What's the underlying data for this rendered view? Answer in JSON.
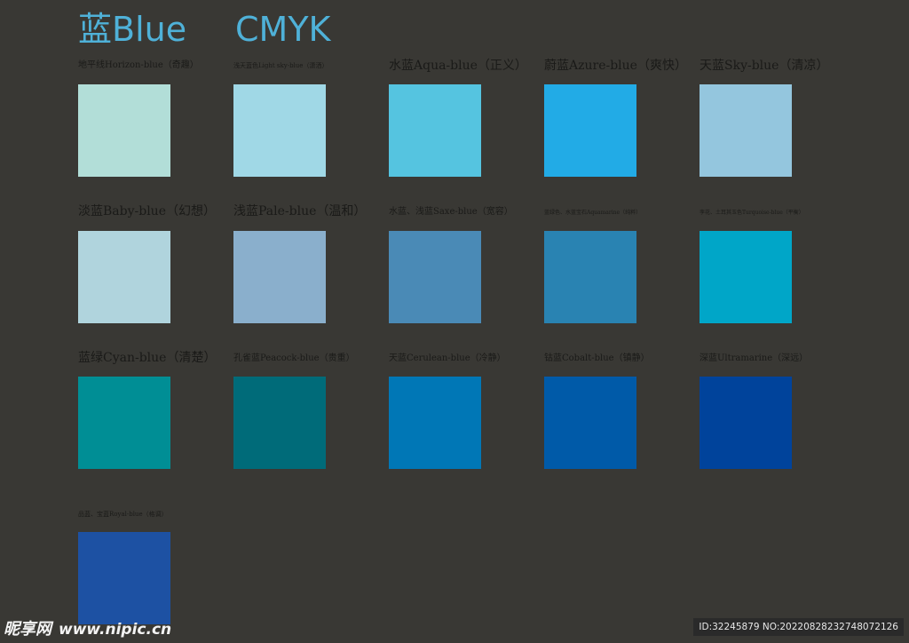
{
  "header": {
    "title_main": "蓝Blue",
    "title_mode": "CMYK"
  },
  "swatches": [
    {
      "label": "地平线Horizon-blue（奇趣）",
      "color": "#b2ded8"
    },
    {
      "label": "浅天蓝色Light sky-blue（潇洒）",
      "color": "#a0d8e6"
    },
    {
      "label": "水蓝Aqua-blue（正义）",
      "color": "#55c4e0"
    },
    {
      "label": "蔚蓝Azure-blue（爽快）",
      "color": "#22abe6"
    },
    {
      "label": "天蓝Sky-blue（清凉）",
      "color": "#94c6de"
    },
    {
      "label": "淡蓝Baby-blue（幻想）",
      "color": "#b0d4dd"
    },
    {
      "label": "浅蓝Pale-blue（温和）",
      "color": "#8aafcc"
    },
    {
      "label": "水蓝、浅蓝Saxe-blue（宽容）",
      "color": "#4a8ab6"
    },
    {
      "label": "蓝绿色、水蓝宝石Aquamarine（纯粹）",
      "color": "#2983b2"
    },
    {
      "label": "孪花、土耳其玉色Turquoise-blue（平衡）",
      "color": "#00a6c8"
    },
    {
      "label": "蓝绿Cyan-blue（清楚）",
      "color": "#008e95"
    },
    {
      "label": "孔雀蓝Peacock-blue（贵重）",
      "color": "#006b79"
    },
    {
      "label": "天蓝Cerulean-blue（冷静）",
      "color": "#0077b6"
    },
    {
      "label": "钴蓝Cobalt-blue（镇静）",
      "color": "#005aa8"
    },
    {
      "label": "深蓝Ultramarine（深远）",
      "color": "#00439b"
    },
    {
      "label": "品蓝、宝蓝Royal-blue（格调）",
      "color": "#1d51a3"
    }
  ],
  "watermark": {
    "brand": "昵享网",
    "url": "www.nipic.cn",
    "id_text": "ID:32245879 NO:20220828232748072126"
  }
}
